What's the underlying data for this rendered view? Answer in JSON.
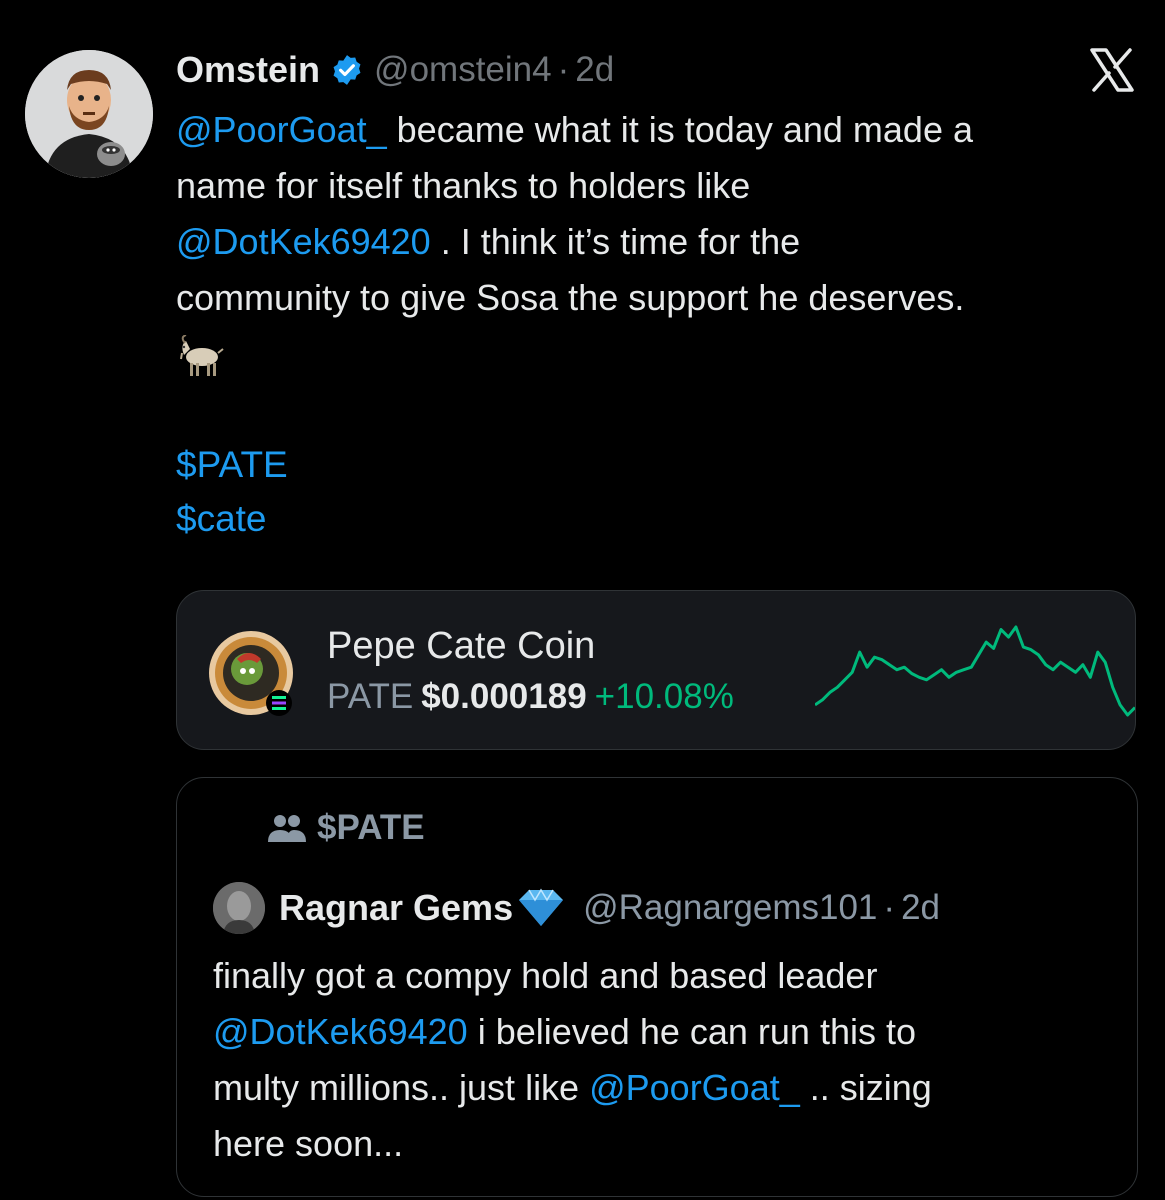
{
  "tweet": {
    "author_name": "Omstein",
    "handle": "@omstein4",
    "separator": "·",
    "time": "2d",
    "lines": [
      {
        "mention": "@PoorGoat_",
        "text": " became what it is today and made a"
      },
      {
        "text": "name for itself thanks to holders like"
      },
      {
        "mention": "@DotKek69420",
        "text": " . I think it’s time for the"
      },
      {
        "text": "community to give Sosa the support he deserves."
      }
    ],
    "emoji": "🐐",
    "cashtags": [
      "$PATE",
      "$cate"
    ]
  },
  "coin_card": {
    "name": "Pepe Cate Coin",
    "ticker": "PATE",
    "price": "$0.000189",
    "change": "+10.08%",
    "chart_data": {
      "type": "line",
      "values": [
        30,
        34,
        40,
        44,
        50,
        56,
        72,
        60,
        68,
        66,
        62,
        58,
        60,
        55,
        52,
        50,
        54,
        58,
        52,
        56,
        58,
        60,
        70,
        80,
        75,
        90,
        84,
        92,
        76,
        74,
        70,
        62,
        58,
        64,
        60,
        56,
        62,
        52,
        72,
        64,
        44,
        30,
        22,
        28
      ]
    },
    "colors": {
      "positive": "#00ba7c",
      "background": "#16181c"
    }
  },
  "quote": {
    "community": "$PATE",
    "author_name": "Ragnar Gems",
    "handle": "@Ragnargems101",
    "separator": "·",
    "time": "2d",
    "lines": [
      {
        "text": "finally got a compy hold and based leader"
      },
      {
        "mention": "@DotKek69420",
        "text": " i believed he can run this to"
      },
      {
        "text": "multy millions.. just like ",
        "mention_after": "@PoorGoat_",
        "text_after": " .. sizing"
      },
      {
        "text": "here soon..."
      }
    ]
  },
  "icons": {
    "verified": "verified-badge-icon",
    "x_logo": "x-logo-icon",
    "community": "community-icon",
    "diamond": "diamond-emoji-icon",
    "solana": "solana-icon"
  },
  "colors": {
    "accent": "#1d9bf0",
    "text": "#e7e9ea",
    "muted": "#71767b",
    "border": "#2f3336"
  }
}
